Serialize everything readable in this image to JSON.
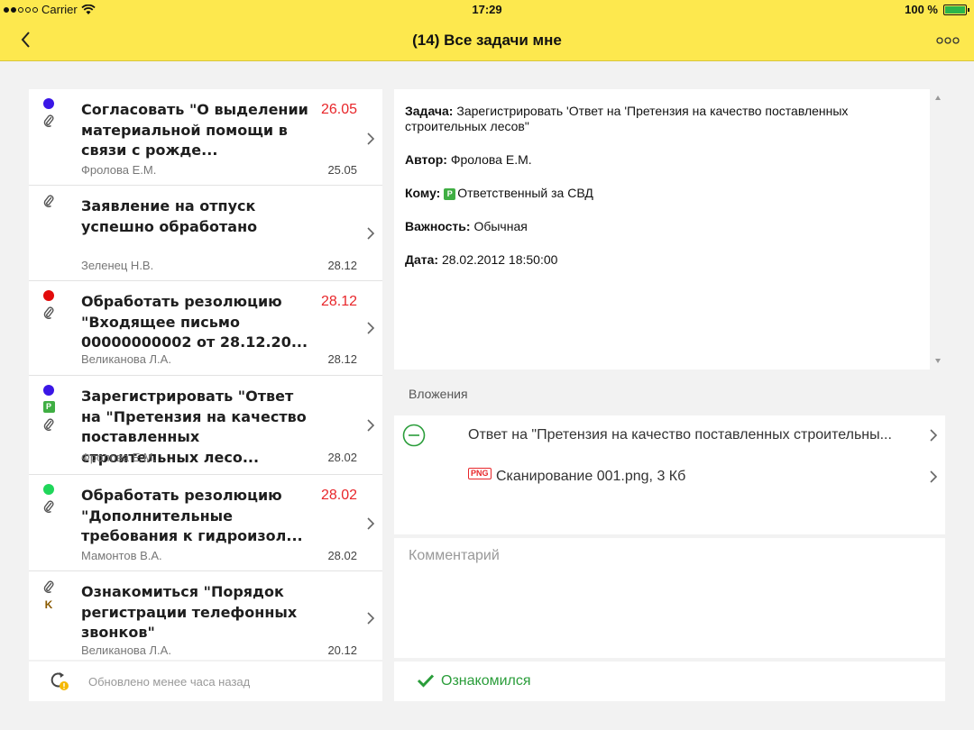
{
  "status_bar": {
    "carrier": "Carrier",
    "time": "17:29",
    "battery": "100 %",
    "battery_level": 1.0
  },
  "nav": {
    "title": "(14) Все задачи мне",
    "back_icon": "chevron-left-icon",
    "more_icon": "more-horizontal-icon"
  },
  "tasks": [
    {
      "title": "Согласовать \"О выделении материальной помощи в связи с рожде...",
      "due": "26.05",
      "author": "Фролова Е.М.",
      "date": "25.05",
      "indicators": [
        "dot-blue",
        "paperclip"
      ]
    },
    {
      "title": "Заявление на отпуск успешно обработано",
      "due": "",
      "author": "Зеленец Н.В.",
      "date": "28.12",
      "indicators": [
        "paperclip"
      ]
    },
    {
      "title": "Обработать резолюцию \"Входящее письмо 00000000002 от 28.12.20...",
      "due": "28.12",
      "author": "Великанова Л.А.",
      "date": "28.12",
      "indicators": [
        "dot-red",
        "paperclip"
      ]
    },
    {
      "title": "Зарегистрировать \"Ответ на \"Претензия на качество поставленных строительных лесо...",
      "due": "",
      "author": "Фролова Е.М.",
      "date": "28.02",
      "indicators": [
        "dot-blue",
        "p-badge",
        "paperclip"
      ]
    },
    {
      "title": "Обработать резолюцию \"Дополнительные требования к гидроизол...",
      "due": "28.02",
      "author": "Мамонтов В.А.",
      "date": "28.02",
      "indicators": [
        "dot-green",
        "paperclip"
      ]
    },
    {
      "title": "Ознакомиться \"Порядок регистрации телефонных звонков\"",
      "due": "",
      "author": "Великанова Л.А.",
      "date": "20.12",
      "indicators": [
        "paperclip",
        "k-badge"
      ]
    }
  ],
  "badges": {
    "p": "P",
    "k": "K"
  },
  "footer": {
    "updated_text": "Обновлено менее часа назад",
    "refresh_icon": "refresh-warning-icon"
  },
  "detail": {
    "task_label": "Задача:",
    "task_value": "Зарегистрировать 'Ответ на 'Претензия на качество поставленных строительных лесов\"",
    "author_label": "Автор:",
    "author_value": "Фролова Е.М.",
    "to_label": "Кому:",
    "to_value": "Ответственный за СВД",
    "importance_label": "Важность:",
    "importance_value": "Обычная",
    "date_label": "Дата:",
    "date_value": "28.02.2012 18:50:00"
  },
  "attachments": {
    "heading": "Вложения",
    "items": [
      {
        "text": "Ответ на \"Претензия на качество поставленных строительны...",
        "icon": "minus-circle-icon"
      },
      {
        "text": "Сканирование 001.png, 3 Кб",
        "icon": "png-file-icon",
        "badge": "PNG"
      }
    ]
  },
  "comment": {
    "placeholder": "Комментарий",
    "value": ""
  },
  "acknowledge": {
    "label": "Ознакомился",
    "icon": "checkmark-icon"
  },
  "colors": {
    "accent_yellow": "#fde84e",
    "due_red": "#e8262a",
    "ack_green": "#2a9d3a",
    "dot_blue": "#3a16e6",
    "dot_red": "#e20b0b",
    "dot_green": "#1fd65a",
    "badge_green": "#3fae43"
  }
}
